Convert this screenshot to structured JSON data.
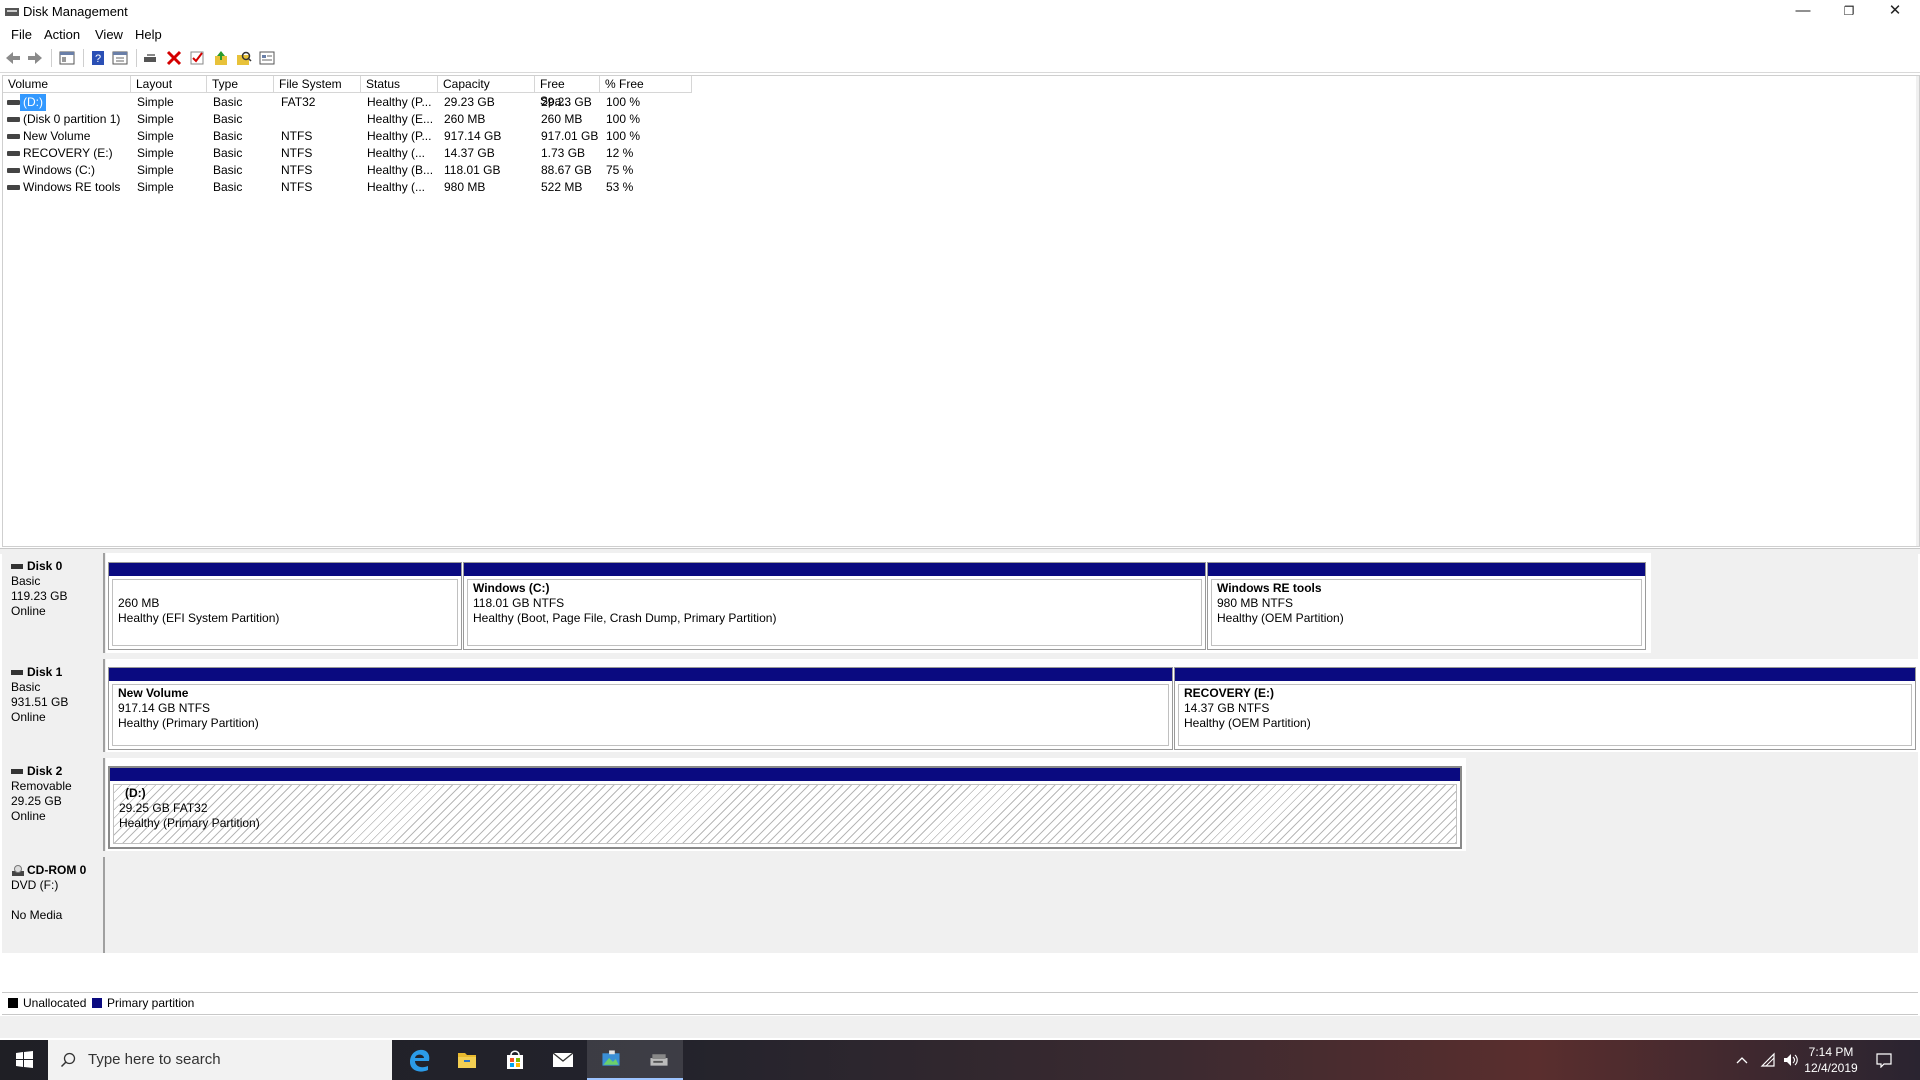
{
  "window": {
    "title": "Disk Management",
    "minimize": "—",
    "restore": "❐",
    "close": "✕"
  },
  "menu": [
    "File",
    "Action",
    "View",
    "Help"
  ],
  "toolbar": [
    "back-icon",
    "forward-icon",
    "show-hide-console-tree-icon",
    "help-icon",
    "properties-icon",
    "connect-icon",
    "delete-icon",
    "check-icon",
    "export-icon",
    "search-icon",
    "view-icon"
  ],
  "list": {
    "columns": [
      "Volume",
      "Layout",
      "Type",
      "File System",
      "Status",
      "Capacity",
      "Free Spa...",
      "% Free"
    ],
    "rows": [
      {
        "volume": "(D:)",
        "layout": "Simple",
        "type": "Basic",
        "fs": "FAT32",
        "status": "Healthy (P...",
        "capacity": "29.23 GB",
        "free": "29.23 GB",
        "pct": "100 %"
      },
      {
        "volume": "(Disk 0 partition 1)",
        "layout": "Simple",
        "type": "Basic",
        "fs": "",
        "status": "Healthy (E...",
        "capacity": "260 MB",
        "free": "260 MB",
        "pct": "100 %"
      },
      {
        "volume": "New Volume",
        "layout": "Simple",
        "type": "Basic",
        "fs": "NTFS",
        "status": "Healthy (P...",
        "capacity": "917.14 GB",
        "free": "917.01 GB",
        "pct": "100 %"
      },
      {
        "volume": "RECOVERY (E:)",
        "layout": "Simple",
        "type": "Basic",
        "fs": "NTFS",
        "status": "Healthy (...",
        "capacity": "14.37 GB",
        "free": "1.73 GB",
        "pct": "12 %"
      },
      {
        "volume": "Windows (C:)",
        "layout": "Simple",
        "type": "Basic",
        "fs": "NTFS",
        "status": "Healthy (B...",
        "capacity": "118.01 GB",
        "free": "88.67 GB",
        "pct": "75 %"
      },
      {
        "volume": "Windows RE tools",
        "layout": "Simple",
        "type": "Basic",
        "fs": "NTFS",
        "status": "Healthy (...",
        "capacity": "980 MB",
        "free": "522 MB",
        "pct": "53 %"
      }
    ]
  },
  "disks": [
    {
      "name": "Disk 0",
      "type": "Basic",
      "size": "119.23 GB",
      "state": "Online",
      "partitions": [
        {
          "title": "",
          "size": "260 MB",
          "status": "Healthy (EFI System Partition)"
        },
        {
          "title": "Windows  (C:)",
          "size": "118.01 GB NTFS",
          "status": "Healthy (Boot, Page File, Crash Dump, Primary Partition)"
        },
        {
          "title": "Windows RE tools",
          "size": "980 MB NTFS",
          "status": "Healthy (OEM Partition)"
        }
      ]
    },
    {
      "name": "Disk 1",
      "type": "Basic",
      "size": "931.51 GB",
      "state": "Online",
      "partitions": [
        {
          "title": "New Volume",
          "size": "917.14 GB NTFS",
          "status": "Healthy (Primary Partition)"
        },
        {
          "title": "RECOVERY  (E:)",
          "size": "14.37 GB NTFS",
          "status": "Healthy (OEM Partition)"
        }
      ]
    },
    {
      "name": "Disk 2",
      "type": "Removable",
      "size": "29.25 GB",
      "state": "Online",
      "partitions": [
        {
          "title": "(D:)",
          "size": "29.25 GB FAT32",
          "status": "Healthy (Primary Partition)"
        }
      ]
    },
    {
      "name": "CD-ROM 0",
      "type": "DVD (F:)",
      "size": "",
      "state": "No Media",
      "partitions": []
    }
  ],
  "legend": {
    "unallocated": "Unallocated",
    "primary": "Primary partition",
    "unallocated_color": "#000000",
    "primary_color": "#0a0a80"
  },
  "taskbar": {
    "search_placeholder": "Type here to search",
    "apps": [
      "edge-icon",
      "file-explorer-icon",
      "store-icon",
      "mail-icon",
      "photos-icon",
      "disk-management-icon"
    ],
    "time": "7:14 PM",
    "date": "12/4/2019"
  }
}
